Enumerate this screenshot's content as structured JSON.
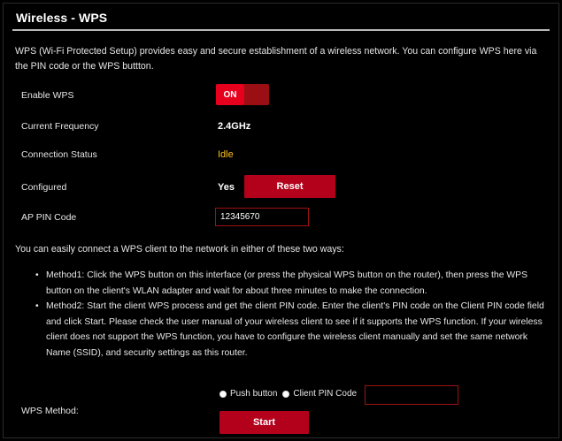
{
  "page": {
    "title": "Wireless - WPS",
    "description": "WPS (Wi-Fi Protected Setup) provides easy and secure establishment of a wireless network. You can configure WPS here via the PIN code or the WPS buttton."
  },
  "settings": {
    "enable_wps": {
      "label": "Enable WPS",
      "state": "ON"
    },
    "current_frequency": {
      "label": "Current Frequency",
      "value": "2.4GHz"
    },
    "connection_status": {
      "label": "Connection Status",
      "value": "Idle"
    },
    "configured": {
      "label": "Configured",
      "value": "Yes",
      "reset_label": "Reset"
    },
    "ap_pin_code": {
      "label": "AP PIN Code",
      "value": "12345670"
    }
  },
  "info_text": "You can easily connect a WPS client to the network in either of these two ways:",
  "methods": [
    "Method1: Click the WPS button on this interface (or press the physical WPS button on the router), then press the WPS button on the client's WLAN adapter and wait for about three minutes to make the connection.",
    "Method2: Start the client WPS process and get the client PIN code. Enter the client's PIN code on the Client PIN code field and click Start. Please check the user manual of your wireless client to see if it supports the WPS function. If your wireless client does not support the WPS function, you have to configure the wireless client manually and set the same network Name (SSID), and security settings as this router."
  ],
  "wps_method": {
    "label": "WPS Method:",
    "options": [
      "Push button",
      "Client PIN Code"
    ],
    "selected": "Client PIN Code",
    "client_pin_value": "",
    "start_label": "Start"
  },
  "colors": {
    "accent": "#b3001b",
    "status_idle": "#ffc21e",
    "background": "#000000"
  }
}
